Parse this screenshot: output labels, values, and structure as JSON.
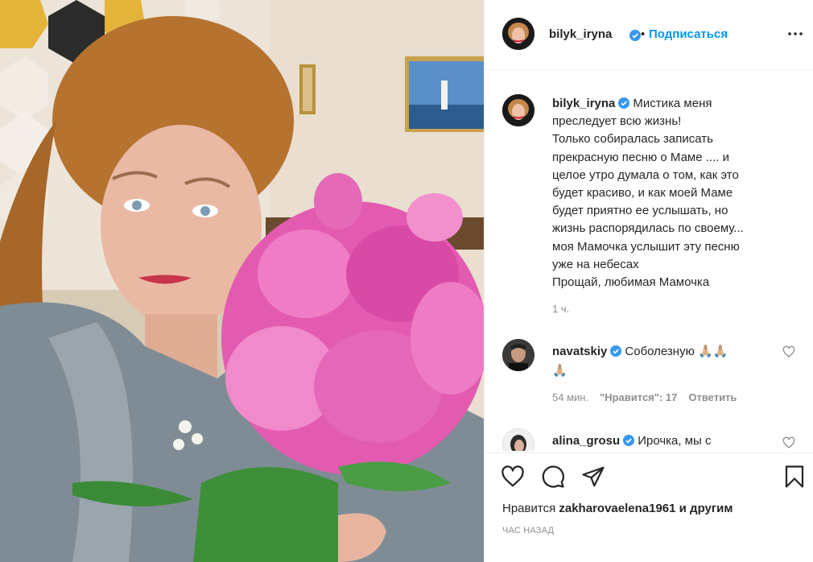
{
  "post": {
    "author": "bilyk_iryna",
    "follow_label": "Подписаться",
    "separator": "•",
    "caption_lines": [
      "Мистика меня",
      "преследует всю жизнь!",
      "Только собиралась записать",
      "прекрасную песню о Маме .... и",
      "целое утро думала о том, как это",
      "будет красиво, и как моей Маме",
      "будет приятно ее услышать, но",
      "жизнь распорядилась по своему...",
      "моя Мамочка услышит эту песню",
      "уже на небесах",
      "Прощай, любимая Мамочка"
    ],
    "caption_time": "1 ч.",
    "likes_prefix": "Нравится",
    "liked_by": "zakharovaelena1961",
    "likes_suffix": "и другим",
    "posted_ago": "ЧАС НАЗАД"
  },
  "comments": [
    {
      "username": "navatskiy",
      "text": "Соболезную 🙏🏼🙏🏼",
      "text_line2": "🙏🏼",
      "time": "54 мин.",
      "likes_label": "\"Нравится\": 17",
      "reply_label": "Ответить"
    },
    {
      "username": "alina_grosu",
      "text": "Ирочка, мы с"
    }
  ],
  "icons": {
    "verified": "verified-badge-icon",
    "more": "more-options-icon",
    "like": "heart-icon",
    "comment": "comment-icon",
    "share": "share-icon",
    "save": "bookmark-icon"
  },
  "colors": {
    "accent": "#0095f6",
    "verified": "#3897f0",
    "muted": "#8e8e8e",
    "border": "#efefef"
  }
}
